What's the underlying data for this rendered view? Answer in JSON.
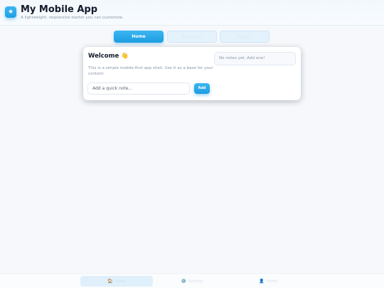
{
  "header": {
    "logo_icon": "★",
    "title": "My Mobile App",
    "subtitle": "A lightweight, responsive starter you can customize."
  },
  "tabs": [
    {
      "label": "Home",
      "active": true
    },
    {
      "label": "Favorites",
      "active": false
    },
    {
      "label": "Profile",
      "active": false
    }
  ],
  "card": {
    "title": "Welcome 👋",
    "description": "This is a simple mobile-first app shell. Use it as a base for your content.",
    "input_placeholder": "Add a quick note...",
    "add_button_label": "Add",
    "notes_empty": "No notes yet. Add one!"
  },
  "bottom_nav": [
    {
      "icon": "home-icon",
      "glyph": "🏠",
      "label": "Home",
      "active": true
    },
    {
      "icon": "gear-icon",
      "glyph": "⚙️",
      "label": "Settings",
      "active": false
    },
    {
      "icon": "user-icon",
      "glyph": "👤",
      "label": "Profile",
      "active": false
    }
  ],
  "colors": {
    "accent": "#1e9fe2",
    "background": "#f6f8fb",
    "text_dark": "#141b2b",
    "text_muted": "#8a96a8"
  }
}
